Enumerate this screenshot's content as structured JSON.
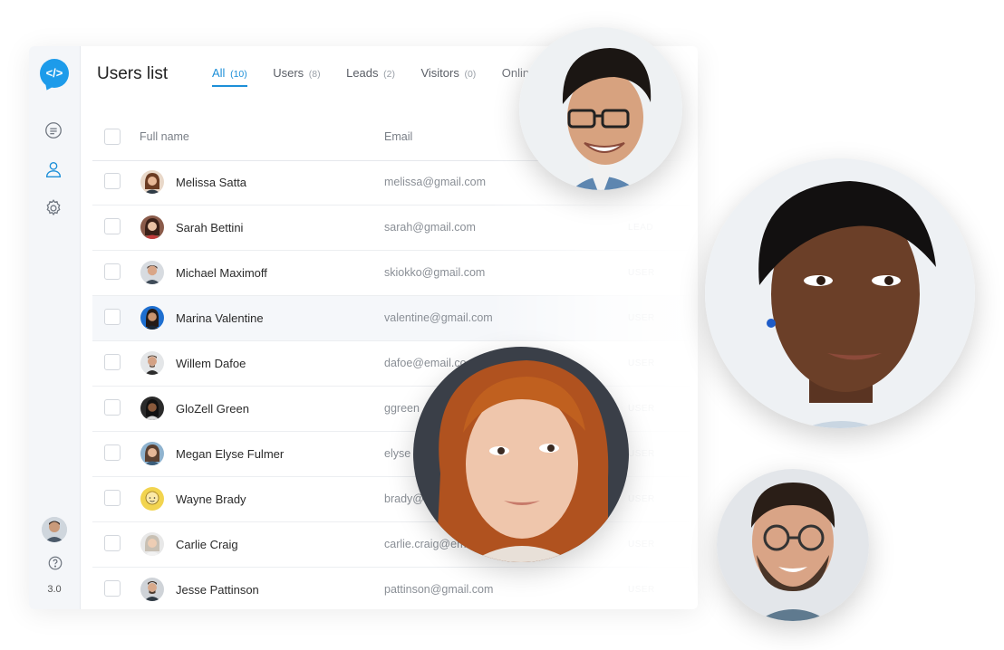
{
  "sidebar": {
    "logo_icon": "code-chat-icon",
    "icons": [
      "chat-icon",
      "user-icon",
      "gear-icon"
    ],
    "help_icon": "help-icon",
    "version": "3.0"
  },
  "header": {
    "title": "Users list",
    "tabs": [
      {
        "label": "All",
        "count": "(10)",
        "active": true
      },
      {
        "label": "Users",
        "count": "(8)",
        "active": false
      },
      {
        "label": "Leads",
        "count": "(2)",
        "active": false
      },
      {
        "label": "Visitors",
        "count": "(0)",
        "active": false
      },
      {
        "label": "Onlin",
        "count": "",
        "active": false
      }
    ]
  },
  "table": {
    "columns": {
      "name": "Full name",
      "email": "Email"
    },
    "rows": [
      {
        "name": "Melissa Satta",
        "email": "melissa@gmail.com",
        "type": ""
      },
      {
        "name": "Sarah Bettini",
        "email": "sarah@gmail.com",
        "type": "LEAD"
      },
      {
        "name": "Michael Maximoff",
        "email": "skiokko@gmail.com",
        "type": "USER"
      },
      {
        "name": "Marina Valentine",
        "email": "valentine@gmail.com",
        "type": "USER"
      },
      {
        "name": "Willem Dafoe",
        "email": "dafoe@email.co",
        "type": "USER"
      },
      {
        "name": "GloZell Green",
        "email": "ggreen",
        "type": "USER"
      },
      {
        "name": "Megan Elyse Fulmer",
        "email": "elyse",
        "type": "USER"
      },
      {
        "name": "Wayne Brady",
        "email": "brady@",
        "type": "USER"
      },
      {
        "name": "Carlie Craig",
        "email": "carlie.craig@em",
        "type": "USER"
      },
      {
        "name": "Jesse Pattinson",
        "email": "pattinson@gmail.com",
        "type": "USER"
      }
    ]
  },
  "colors": {
    "accent": "#1d8fd8",
    "sidebar_bg": "#f4f6f9"
  }
}
